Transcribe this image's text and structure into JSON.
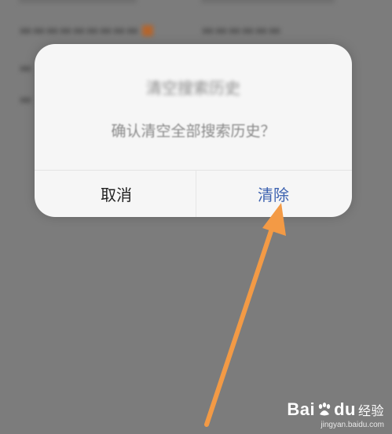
{
  "background": {
    "rows": [
      {
        "text": "...",
        "hot": true
      },
      {
        "text": "...",
        "hot": false
      },
      {
        "text": "...",
        "hot": false
      },
      {
        "text": "...",
        "hot": false
      }
    ]
  },
  "dialog": {
    "title": "清空搜索历史",
    "message": "确认清空全部搜索历史？",
    "cancel_label": "取消",
    "clear_label": "清除"
  },
  "watermark": {
    "brand_left": "Bai",
    "brand_right": "du",
    "suffix": "经验",
    "sub": "jingyan.baidu.com"
  },
  "colors": {
    "overlay": "#7c7c7c",
    "dialog_bg": "#f6f6f6",
    "clear_text": "#3d62b0",
    "cancel_text": "#222222",
    "arrow": "#f39a45"
  },
  "icons": {
    "arrow": "annotation-arrow",
    "paw": "baidu-paw-icon"
  }
}
